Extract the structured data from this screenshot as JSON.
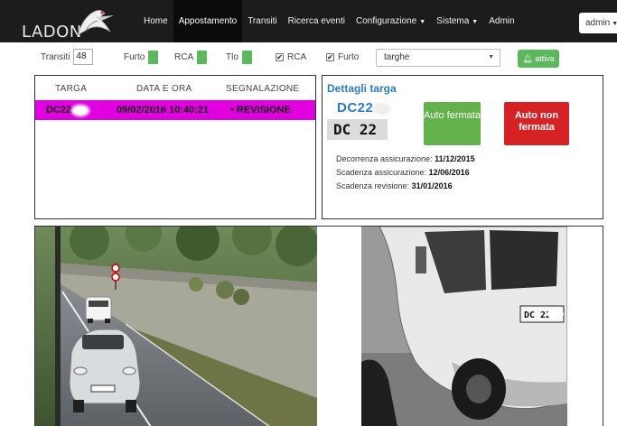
{
  "app": {
    "logo_text": "LADON"
  },
  "nav": {
    "items": [
      {
        "label": "Home",
        "active": false
      },
      {
        "label": "Appostamento",
        "active": true
      },
      {
        "label": "Transiti",
        "active": false
      },
      {
        "label": "Ricerca eventi",
        "active": false
      },
      {
        "label": "Configurazione",
        "active": false,
        "dropdown": true
      },
      {
        "label": "Sistema",
        "active": false,
        "dropdown": true
      },
      {
        "label": "Admin",
        "active": false
      }
    ],
    "user": "admin"
  },
  "filters": {
    "transiti_label": "Transiti",
    "transiti_value": "48",
    "furto_label": "Furto",
    "rca_label": "RCA",
    "tlo_label": "Tlo",
    "rca_check_label": "RCA",
    "furto_check_label": "Furto",
    "select_value": "targhe",
    "attiva_label": "attiva"
  },
  "table": {
    "headers": [
      "TARGA",
      "DATA E ORA",
      "SEGNALAZIONE"
    ],
    "rows": [
      {
        "targa": "DC22",
        "data_ora": "09/02/2016 10:40:21",
        "segnalazione": "REVISIONE"
      }
    ]
  },
  "details": {
    "title": "Dettagli targa",
    "plate": "DC22",
    "plate_image_text": "DC 22",
    "btn_fermata": "Auto fermata",
    "btn_non_fermata": "Auto non fermata",
    "decorrenza_label": "Decorrenza assicurazione:",
    "decorrenza_value": "11/12/2015",
    "scadenza_ass_label": "Scadenza assicurazione:",
    "scadenza_ass_value": "12/06/2016",
    "scadenza_rev_label": "Scadenza revisione:",
    "scadenza_rev_value": "31/01/2016"
  },
  "camera": {
    "plate_crop_text": "DC 22"
  },
  "colors": {
    "navbar": "#1c1c1c",
    "highlight_row": "#e000e0",
    "accent_blue": "#2a7bc4",
    "green": "#62b14a",
    "red": "#d62224"
  }
}
